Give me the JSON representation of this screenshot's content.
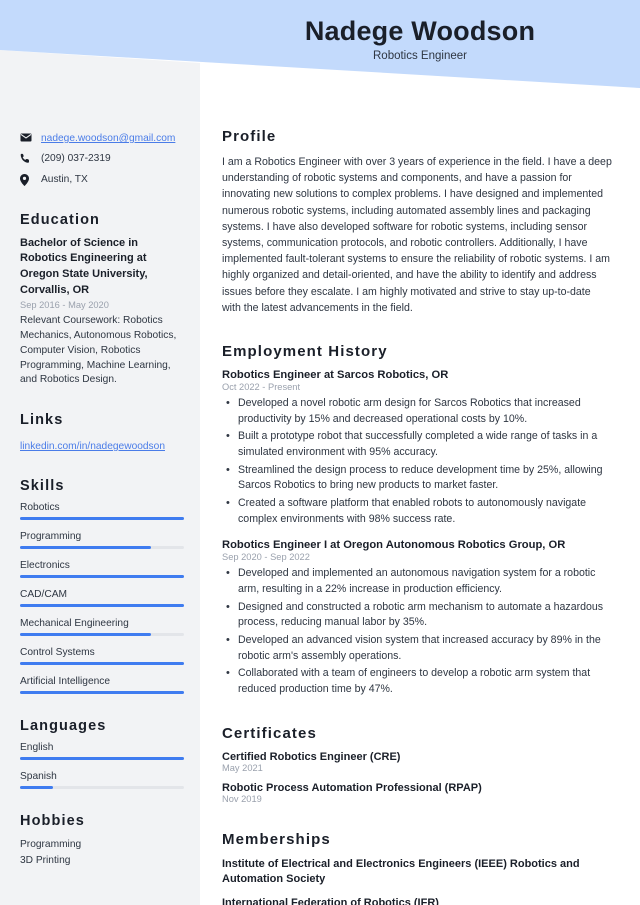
{
  "header": {
    "name": "Nadege Woodson",
    "job_title": "Robotics Engineer",
    "band_color": "#c3dafc"
  },
  "theme": {
    "accent": "#3f7cf0",
    "link": "#4a7ce8",
    "sidebar_bg": "#f2f3f5",
    "text": "#2e3642",
    "heading": "#1a1f29",
    "muted": "#9aa1ad"
  },
  "sidebar": {
    "contact": [
      {
        "icon": "envelope-icon",
        "text": "nadege.woodson@gmail.com",
        "is_link": true
      },
      {
        "icon": "phone-icon",
        "text": "(209) 037-2319",
        "is_link": false
      },
      {
        "icon": "location-pin-icon",
        "text": "Austin, TX",
        "is_link": false
      }
    ],
    "education": {
      "heading": "Education",
      "degree": "Bachelor of Science in Robotics Engineering at Oregon State University, Corvallis, OR",
      "date": "Sep 2016 - May 2020",
      "coursework": "Relevant Coursework: Robotics Mechanics, Autonomous Robotics, Computer Vision, Robotics Programming, Machine Learning, and Robotics Design."
    },
    "links": {
      "heading": "Links",
      "items": [
        {
          "label": "linkedin.com/in/nadegewoodson"
        }
      ]
    },
    "skills": {
      "heading": "Skills",
      "items": [
        {
          "label": "Robotics",
          "level": 100
        },
        {
          "label": "Programming",
          "level": 80
        },
        {
          "label": "Electronics",
          "level": 100
        },
        {
          "label": "CAD/CAM",
          "level": 100
        },
        {
          "label": "Mechanical Engineering",
          "level": 80
        },
        {
          "label": "Control Systems",
          "level": 100
        },
        {
          "label": "Artificial Intelligence",
          "level": 100
        }
      ]
    },
    "languages": {
      "heading": "Languages",
      "items": [
        {
          "label": "English",
          "level": 100
        },
        {
          "label": "Spanish",
          "level": 20
        }
      ]
    },
    "hobbies": {
      "heading": "Hobbies",
      "items": [
        {
          "label": "Programming"
        },
        {
          "label": "3D Printing"
        }
      ]
    }
  },
  "main": {
    "profile": {
      "heading": "Profile",
      "text": "I am a Robotics Engineer with over 3 years of experience in the field. I have a deep understanding of robotic systems and components, and have a passion for innovating new solutions to complex problems. I have designed and implemented numerous robotic systems, including automated assembly lines and packaging systems. I have also developed software for robotic systems, including sensor systems, communication protocols, and robotic controllers. Additionally, I have implemented fault-tolerant systems to ensure the reliability of robotic systems. I am highly organized and detail-oriented, and have the ability to identify and address issues before they escalate. I am highly motivated and strive to stay up-to-date with the latest advancements in the field."
    },
    "employment": {
      "heading": "Employment History",
      "jobs": [
        {
          "title": "Robotics Engineer at Sarcos Robotics, OR",
          "date": "Oct 2022 - Present",
          "bullets": [
            "Developed a novel robotic arm design for Sarcos Robotics that increased productivity by 15% and decreased operational costs by 10%.",
            "Built a prototype robot that successfully completed a wide range of tasks in a simulated environment with 95% accuracy.",
            "Streamlined the design process to reduce development time by 25%, allowing Sarcos Robotics to bring new products to market faster.",
            "Created a software platform that enabled robots to autonomously navigate complex environments with 98% success rate."
          ]
        },
        {
          "title": "Robotics Engineer I at Oregon Autonomous Robotics Group, OR",
          "date": "Sep 2020 - Sep 2022",
          "bullets": [
            "Developed and implemented an autonomous navigation system for a robotic arm, resulting in a 22% increase in production efficiency.",
            "Designed and constructed a robotic arm mechanism to automate a hazardous process, reducing manual labor by 35%.",
            "Developed an advanced vision system that increased accuracy by 89% in the robotic arm's assembly operations.",
            "Collaborated with a team of engineers to develop a robotic arm system that reduced production time by 47%."
          ]
        }
      ]
    },
    "certificates": {
      "heading": "Certificates",
      "items": [
        {
          "name": "Certified Robotics Engineer (CRE)",
          "date": "May 2021"
        },
        {
          "name": "Robotic Process Automation Professional (RPAP)",
          "date": "Nov 2019"
        }
      ]
    },
    "memberships": {
      "heading": "Memberships",
      "items": [
        {
          "name": "Institute of Electrical and Electronics Engineers (IEEE) Robotics and Automation Society"
        },
        {
          "name": "International Federation of Robotics (IFR)"
        }
      ]
    }
  }
}
